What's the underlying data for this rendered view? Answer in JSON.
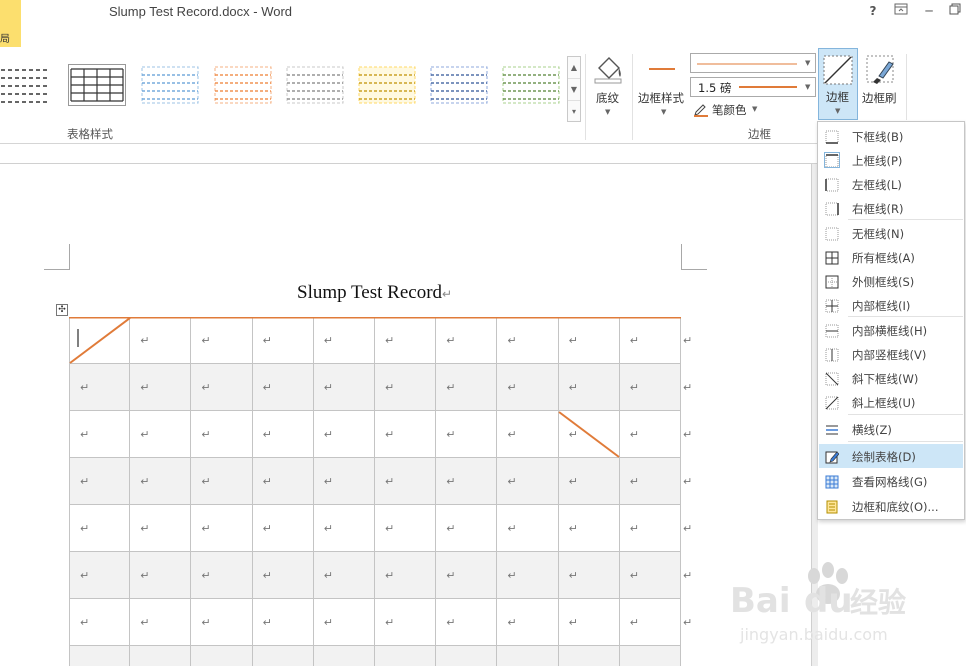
{
  "window": {
    "title": "Slump Test Record.docx - Word",
    "file_tab_fragment": "局",
    "help": "?",
    "restore": "⊡",
    "minimize": "─",
    "maximize": "🗗"
  },
  "ribbon": {
    "gallery_group_label": "表格样式",
    "shading_label": "底纹",
    "border_styles_label": "边框样式",
    "line_weight": "1.5 磅",
    "pen_color_label": "笔颜色",
    "borders_label": "边框",
    "border_painter_label": "边框刷",
    "borders_group_label": "边框",
    "accent": "#e07b39"
  },
  "document": {
    "title": "Slump Test Record",
    "para_mark": "↵",
    "move_handle": "✣",
    "cell_mark": "↵"
  },
  "menu": {
    "items": [
      {
        "label": "下框线(B)",
        "icon": "bottom-border-icon"
      },
      {
        "label": "上框线(P)",
        "icon": "top-border-icon"
      },
      {
        "label": "左框线(L)",
        "icon": "left-border-icon"
      },
      {
        "label": "右框线(R)",
        "icon": "right-border-icon"
      },
      {
        "label": "无框线(N)",
        "icon": "no-border-icon"
      },
      {
        "label": "所有框线(A)",
        "icon": "all-borders-icon"
      },
      {
        "label": "外侧框线(S)",
        "icon": "outside-borders-icon"
      },
      {
        "label": "内部框线(I)",
        "icon": "inside-borders-icon"
      },
      {
        "label": "内部横框线(H)",
        "icon": "inside-horizontal-border-icon"
      },
      {
        "label": "内部竖框线(V)",
        "icon": "inside-vertical-border-icon"
      },
      {
        "label": "斜下框线(W)",
        "icon": "diagonal-down-border-icon"
      },
      {
        "label": "斜上框线(U)",
        "icon": "diagonal-up-border-icon"
      },
      {
        "label": "横线(Z)",
        "icon": "horizontal-line-icon"
      },
      {
        "label": "绘制表格(D)",
        "icon": "draw-table-icon"
      },
      {
        "label": "查看网格线(G)",
        "icon": "view-gridlines-icon"
      },
      {
        "label": "边框和底纹(O)...",
        "icon": "borders-and-shading-icon"
      }
    ]
  },
  "watermark": {
    "brand": "Bai du",
    "brand_cn": "经验",
    "url": "jingyan.baidu.com"
  }
}
